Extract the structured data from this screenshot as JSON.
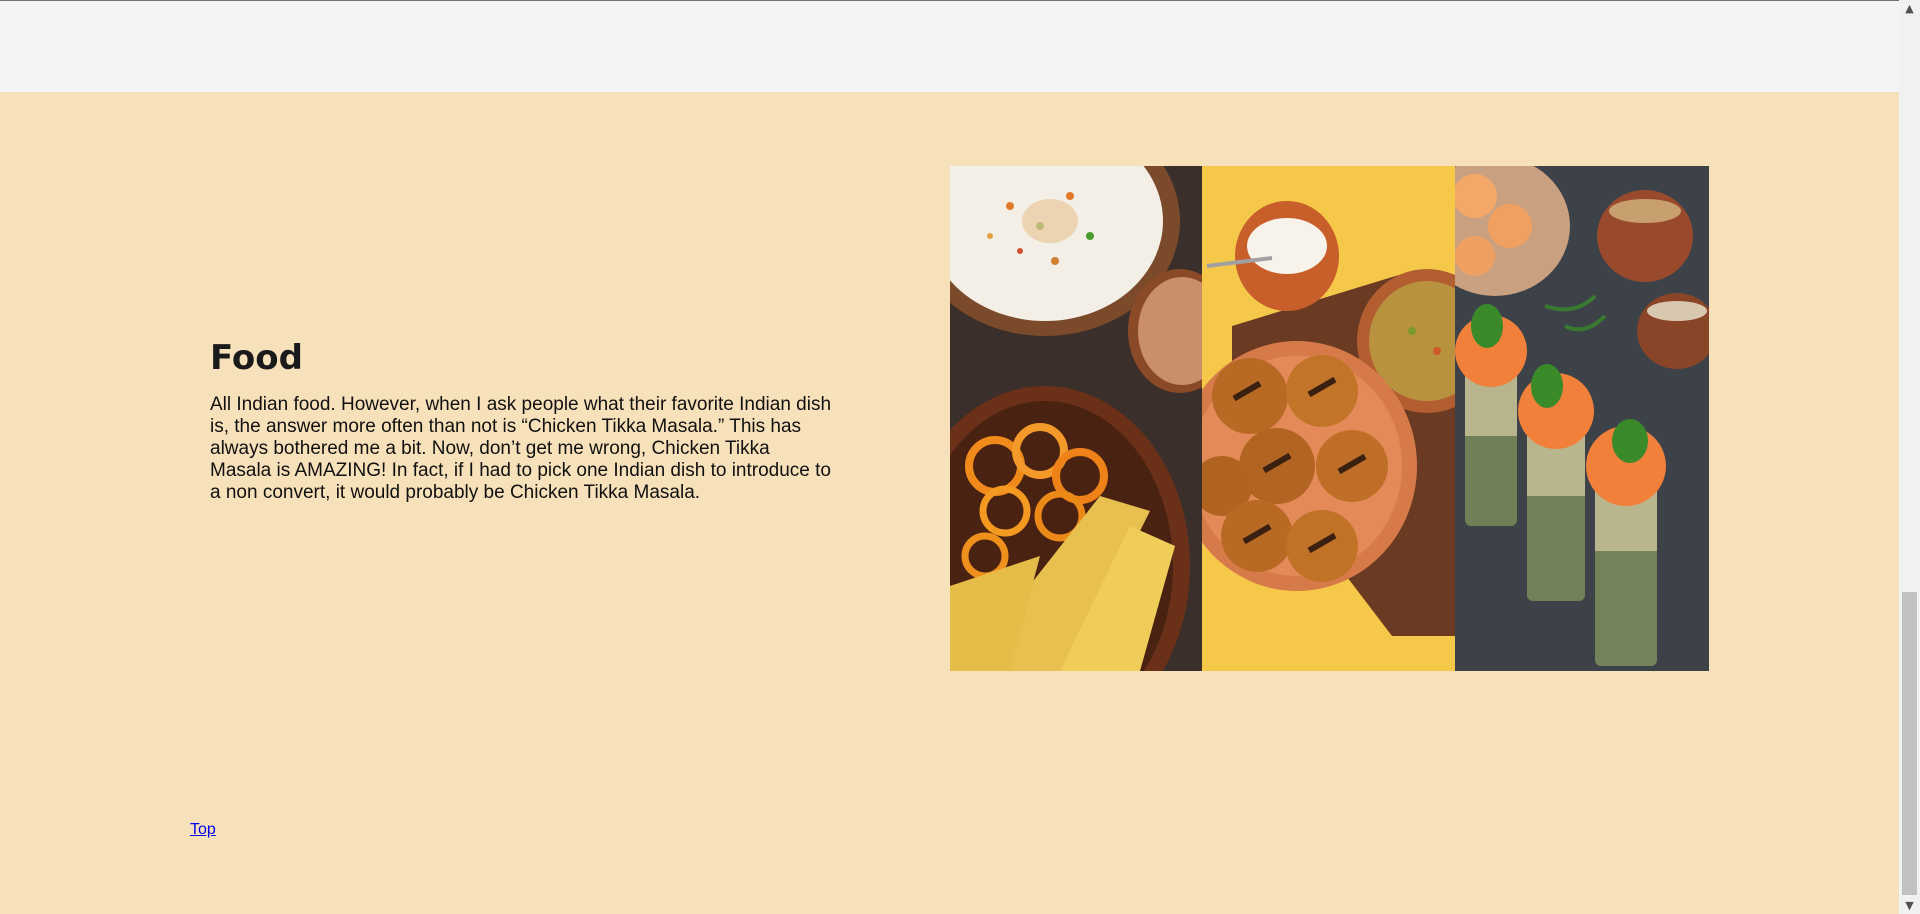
{
  "food_section": {
    "title": "Food",
    "body": "All Indian food. However, when I ask people what their favorite Indian dish is, the answer more often than not is “Chicken Tikka Masala.” This has always bothered me a bit. Now, don’t get me wrong, Chicken Tikka Masala is AMAZING! In fact, if I had to pick one Indian dish to introduce to a non convert, it would probably be Chicken Tikka Masala."
  },
  "gallery": {
    "photos": [
      {
        "name": "dahi-vada-jalebi-photo"
      },
      {
        "name": "litti-chokha-photo"
      },
      {
        "name": "pani-puri-shots-photo"
      }
    ]
  },
  "footer": {
    "top_link": "Top"
  },
  "colors": {
    "section_bg": "#f7e1ba",
    "top_strip_bg": "#f4f4f4",
    "link": "#0000ee"
  },
  "icons": {
    "scroll_up": "chevron-up-icon",
    "scroll_down": "chevron-down-icon"
  }
}
